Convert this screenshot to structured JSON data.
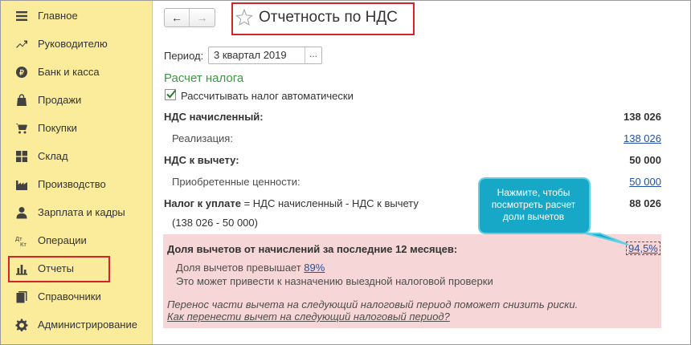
{
  "sidebar": {
    "items": [
      {
        "label": "Главное",
        "icon": "menu-icon"
      },
      {
        "label": "Руководителю",
        "icon": "trend-icon"
      },
      {
        "label": "Банк и касса",
        "icon": "coin-icon"
      },
      {
        "label": "Продажи",
        "icon": "bag-icon"
      },
      {
        "label": "Покупки",
        "icon": "cart-icon"
      },
      {
        "label": "Склад",
        "icon": "warehouse-icon"
      },
      {
        "label": "Производство",
        "icon": "factory-icon"
      },
      {
        "label": "Зарплата и кадры",
        "icon": "person-icon"
      },
      {
        "label": "Операции",
        "icon": "dt-kt-icon"
      },
      {
        "label": "Отчеты",
        "icon": "bar-chart-icon"
      },
      {
        "label": "Справочники",
        "icon": "books-icon"
      },
      {
        "label": "Администрирование",
        "icon": "gear-icon"
      }
    ],
    "active_index": 9,
    "highlight_color": "#d3242a",
    "background": "#fbec9c"
  },
  "header": {
    "title": "Отчетность по НДС",
    "back_label": "←",
    "forward_label": "→"
  },
  "period": {
    "label": "Период:",
    "value": "3 квартал 2019",
    "picker_label": "..."
  },
  "calc": {
    "section_title": "Расчет налога",
    "auto_checkbox_label": "Рассчитывать налог автоматически",
    "auto_checked": true,
    "vat_accrued_label": "НДС начисленный:",
    "vat_accrued_value": "138 026",
    "sales_label": "Реализация:",
    "sales_value": "138 026",
    "vat_deduct_label": "НДС к вычету:",
    "vat_deduct_value": "50 000",
    "acquired_label": "Приобретенные ценности:",
    "acquired_value": "50 000",
    "tax_due_label": "Налог к уплате",
    "tax_due_formula": " = НДС начисленный - НДС к вычету",
    "tax_due_value": "88 026",
    "tax_due_calc": "(138 026 - 50 000)"
  },
  "deduction_panel": {
    "title": "Доля вычетов от начислений за последние 12 месяцев:",
    "value": "94,5%",
    "exceeds_prefix": "Доля вычетов превышает ",
    "exceeds_threshold": "89%",
    "warning": "Это может привести к назначению выездной налоговой проверки",
    "advice": "Перенос части вычета на следующий налоговый период поможет снизить риски.",
    "advice_link": "Как перенести вычет на следующий налоговый период?",
    "background": "#f6d6d6"
  },
  "callout": {
    "line1": "Нажмите, чтобы",
    "line2": "посмотреть расчет",
    "line3": "доли вычетов",
    "color": "#17a8c8"
  },
  "colors": {
    "accent_green": "#3a9a3e",
    "link_blue": "#2450a4",
    "red_outline": "#d3242a"
  }
}
